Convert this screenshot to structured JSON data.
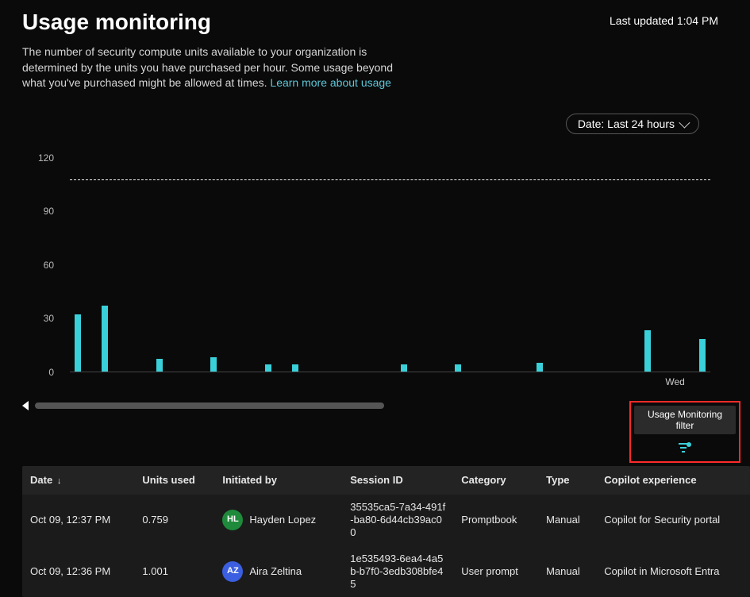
{
  "header": {
    "title": "Usage monitoring",
    "last_updated": "Last updated 1:04 PM"
  },
  "description": {
    "text": "The number of security compute units available to your organization is determined by the units you have purchased per hour. Some usage beyond what you've purchased might be allowed at times. ",
    "link_text": "Learn more about usage"
  },
  "date_filter": {
    "label": "Date: Last 24 hours"
  },
  "chart_data": {
    "type": "bar",
    "ylim": [
      0,
      120
    ],
    "y_ticks": [
      0,
      30,
      60,
      90,
      120
    ],
    "reference_line": 108,
    "categories": [
      "",
      "",
      "",
      "",
      "",
      "",
      "",
      "",
      "",
      "",
      "",
      "",
      "",
      "",
      "",
      "",
      "",
      "",
      "",
      "",
      "",
      "",
      "Wed",
      ""
    ],
    "values": [
      32,
      37,
      0,
      7,
      0,
      8,
      0,
      4,
      4,
      0,
      0,
      0,
      4,
      0,
      4,
      0,
      0,
      5,
      0,
      0,
      0,
      23,
      0,
      18
    ],
    "xlabel": "",
    "ylabel": "",
    "title": ""
  },
  "filter_callout": {
    "tooltip": "Usage Monitoring filter"
  },
  "table": {
    "columns": {
      "date": "Date",
      "units": "Units used",
      "initiated": "Initiated by",
      "session": "Session ID",
      "category": "Category",
      "type": "Type",
      "copilot_exp": "Copilot experience"
    },
    "rows": [
      {
        "date": "Oct 09, 12:37 PM",
        "units": "0.759",
        "initials": "HL",
        "avatar_color": "#1f8a3b",
        "name": "Hayden Lopez",
        "session": "35535ca5-7a34-491f-ba80-6d44cb39ac00",
        "category": "Promptbook",
        "type": "Manual",
        "copilot_exp": "Copilot for Security portal"
      },
      {
        "date": "Oct 09, 12:36 PM",
        "units": "1.001",
        "initials": "AZ",
        "avatar_color": "#3b5fe0",
        "name": "Aira Zeltina",
        "session": "1e535493-6ea4-4a5b-b7f0-3edb308bfe45",
        "category": "User prompt",
        "type": "Manual",
        "copilot_exp": "Copilot in Microsoft Entra"
      }
    ]
  }
}
